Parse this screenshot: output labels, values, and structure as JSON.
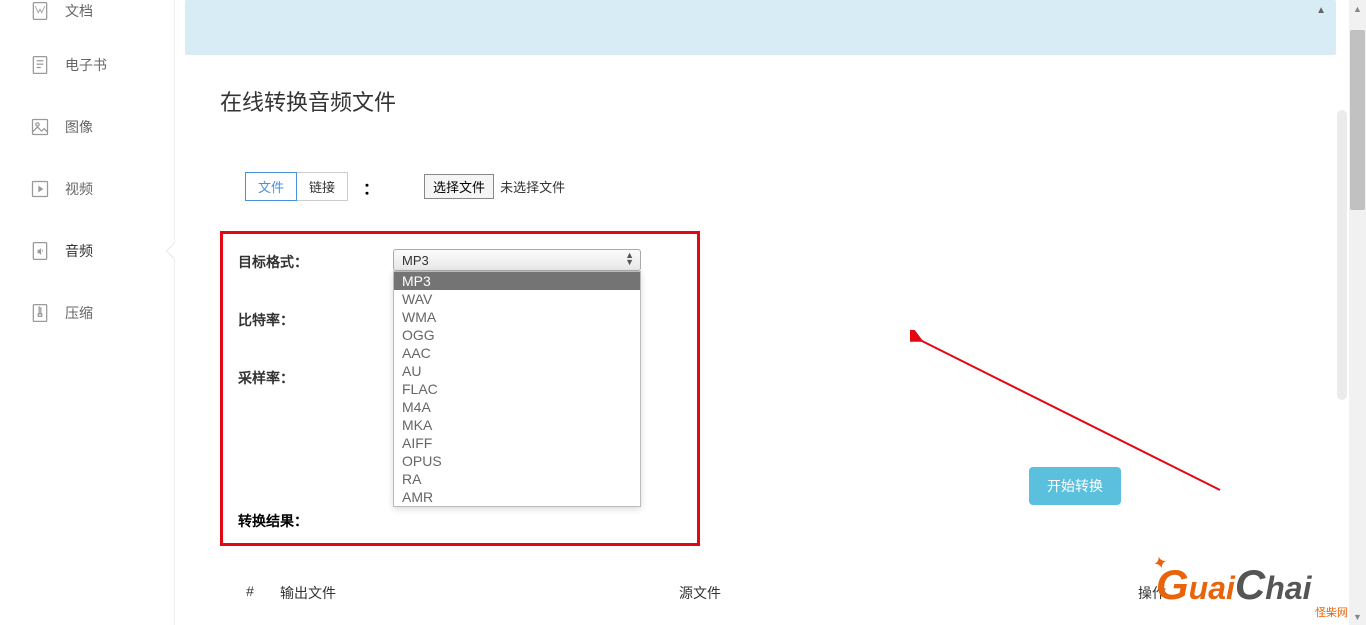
{
  "sidebar": {
    "items": [
      {
        "label": "文档",
        "icon": "document-icon"
      },
      {
        "label": "电子书",
        "icon": "ebook-icon"
      },
      {
        "label": "图像",
        "icon": "image-icon"
      },
      {
        "label": "视频",
        "icon": "video-icon"
      },
      {
        "label": "音频",
        "icon": "audio-icon"
      },
      {
        "label": "压缩",
        "icon": "archive-icon"
      }
    ]
  },
  "page": {
    "title": "在线转换音频文件"
  },
  "tabs": {
    "file": "文件",
    "link": "链接",
    "separator": "："
  },
  "file_input": {
    "button": "选择文件",
    "status": "未选择文件"
  },
  "form": {
    "target_format_label": "目标格式：",
    "target_format_value": "MP3",
    "bitrate_label": "比特率：",
    "sample_rate_label": "采样率：",
    "result_label": "转换结果："
  },
  "dropdown": {
    "options": [
      "MP3",
      "WAV",
      "WMA",
      "OGG",
      "AAC",
      "AU",
      "FLAC",
      "M4A",
      "MKA",
      "AIFF",
      "OPUS",
      "RA",
      "AMR"
    ]
  },
  "actions": {
    "convert": "开始转换"
  },
  "table": {
    "col_num": "#",
    "col_output": "输出文件",
    "col_source": "源文件",
    "col_op": "操作"
  },
  "logo": {
    "part1": "G",
    "part2": "uai",
    "part3": "C",
    "part4": "hai",
    "subtitle": "怪柴网"
  }
}
